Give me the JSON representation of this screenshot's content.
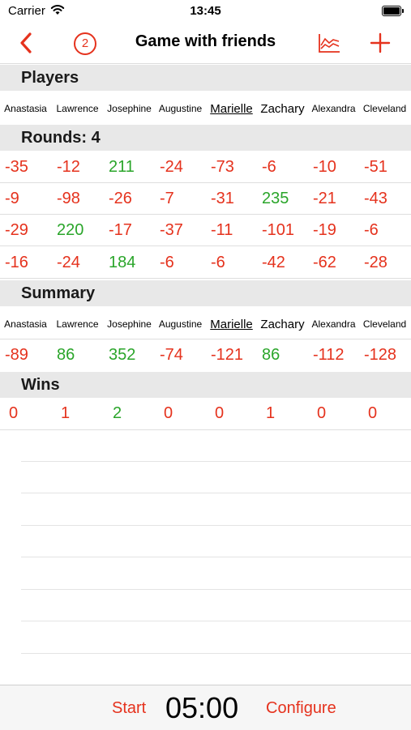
{
  "status_bar": {
    "carrier": "Carrier",
    "time": "13:45",
    "wifi_icon": "wifi-icon",
    "battery_icon": "battery-icon"
  },
  "nav": {
    "title": "Game with friends",
    "badge": "2",
    "back_icon": "chevron-left-icon",
    "chart_icon": "line-chart-icon",
    "add_icon": "plus-icon",
    "accent_color": "#e5321d"
  },
  "sections": {
    "players": "Players",
    "rounds": "Rounds: 4",
    "summary": "Summary",
    "wins": "Wins"
  },
  "players": [
    "Anastasia",
    "Lawrence",
    "Josephine",
    "Augustine",
    "Marielle",
    "Zachary",
    "Alexandra",
    "Cleveland"
  ],
  "selected_player": "Marielle",
  "rounds": [
    [
      "-35",
      "-12",
      "211",
      "-24",
      "-73",
      "-6",
      "-10",
      "-51"
    ],
    [
      "-9",
      "-98",
      "-26",
      "-7",
      "-31",
      "235",
      "-21",
      "-43"
    ],
    [
      "-29",
      "220",
      "-17",
      "-37",
      "-11",
      "-101",
      "-19",
      "-6"
    ],
    [
      "-16",
      "-24",
      "184",
      "-6",
      "-6",
      "-42",
      "-62",
      "-28"
    ]
  ],
  "summary": [
    "-89",
    "86",
    "352",
    "-74",
    "-121",
    "86",
    "-112",
    "-128"
  ],
  "wins": [
    "0",
    "1",
    "2",
    "0",
    "0",
    "1",
    "0",
    "0"
  ],
  "bottom": {
    "start_label": "Start",
    "timer": "05:00",
    "configure_label": "Configure"
  },
  "colors": {
    "negative": "#e5321d",
    "positive": "#2aa52a",
    "section_bg": "#e8e8e8"
  }
}
